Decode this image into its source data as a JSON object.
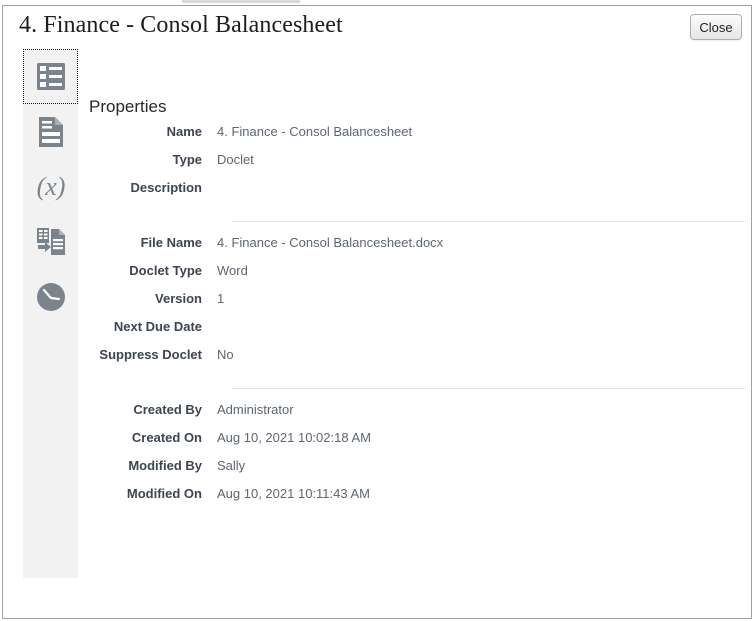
{
  "window": {
    "title": "4. Finance - Consol Balancesheet",
    "close_label": "Close"
  },
  "sidebar": {
    "items": [
      {
        "name": "properties",
        "icon": "properties-list-icon",
        "selected": true
      },
      {
        "name": "content",
        "icon": "document-icon",
        "selected": false
      },
      {
        "name": "variables",
        "icon": "variable-x-icon",
        "selected": false
      },
      {
        "name": "embedded-content",
        "icon": "embedded-content-icon",
        "selected": false
      },
      {
        "name": "history",
        "icon": "clock-history-icon",
        "selected": false
      }
    ]
  },
  "main": {
    "section_title": "Properties",
    "groups": [
      {
        "fields": [
          {
            "label": "Name",
            "value": "4. Finance - Consol Balancesheet"
          },
          {
            "label": "Type",
            "value": "Doclet"
          },
          {
            "label": "Description",
            "value": ""
          }
        ]
      },
      {
        "fields": [
          {
            "label": "File Name",
            "value": "4. Finance - Consol Balancesheet.docx"
          },
          {
            "label": "Doclet Type",
            "value": "Word"
          },
          {
            "label": "Version",
            "value": "1"
          },
          {
            "label": "Next Due Date",
            "value": ""
          },
          {
            "label": "Suppress Doclet",
            "value": "No"
          }
        ]
      },
      {
        "fields": [
          {
            "label": "Created By",
            "value": "Administrator"
          },
          {
            "label": "Created On",
            "value": "Aug 10, 2021 10:02:18 AM"
          },
          {
            "label": "Modified By",
            "value": "Sally"
          },
          {
            "label": "Modified On",
            "value": "Aug 10, 2021 10:11:43 AM"
          }
        ]
      }
    ]
  },
  "colors": {
    "icon_gray": "#7b838c",
    "label_text": "#3d4551",
    "value_text": "#5d6671",
    "rail_bg": "#f2f2f2",
    "divider": "#e2e2e2",
    "dialog_border": "#9aa0a6"
  }
}
